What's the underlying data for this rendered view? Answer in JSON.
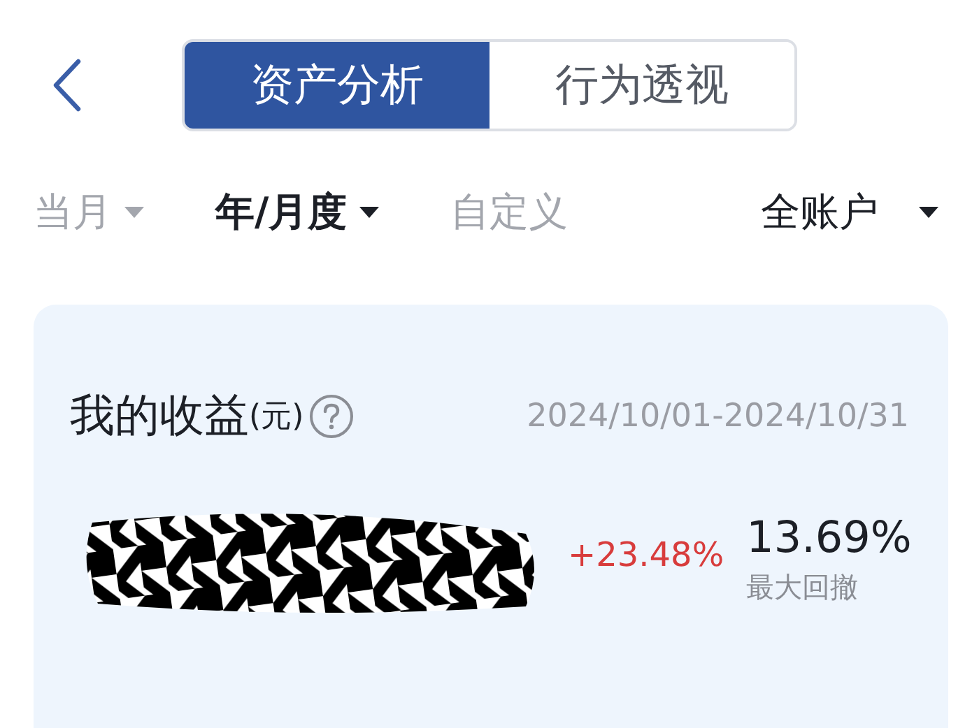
{
  "tabs": [
    {
      "label": "资产分析",
      "selected": true
    },
    {
      "label": "行为透视",
      "selected": false
    }
  ],
  "filters": [
    {
      "label": "当月",
      "selected": false,
      "has_menu": true
    },
    {
      "label": "年/月度",
      "selected": true,
      "has_menu": true
    },
    {
      "label": "自定义",
      "selected": false,
      "has_menu": false
    }
  ],
  "account_filter": {
    "label": "全账户"
  },
  "card": {
    "title": "我的收益",
    "unit": "(元)",
    "date_range": "2024/10/01-2024/10/31",
    "return_rate": "+23.48%",
    "max_drawdown": "13.69%",
    "max_drawdown_label": "最大回撤"
  }
}
